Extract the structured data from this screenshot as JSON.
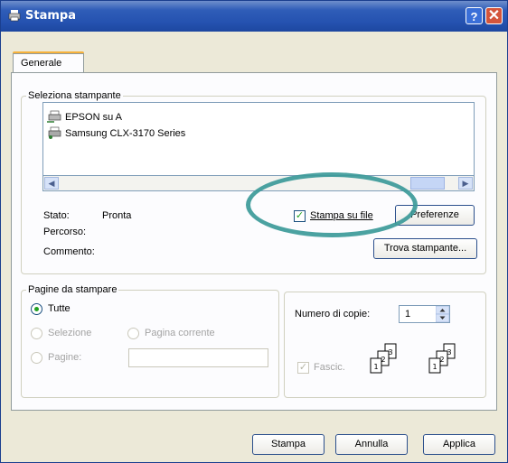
{
  "window": {
    "title": "Stampa",
    "help_glyph": "?",
    "close_glyph": "✕"
  },
  "tabs": [
    "Generale"
  ],
  "printer_group": {
    "legend": "Seleziona stampante",
    "printers": [
      "EPSON su A",
      "Samsung CLX-3170 Series"
    ],
    "status_label": "Stato:",
    "status_value": "Pronta",
    "location_label": "Percorso:",
    "comment_label": "Commento:",
    "print_to_file_label": "Stampa su file",
    "print_to_file_checked": true,
    "preferences_button": "Preferenze",
    "find_printer_button": "Trova stampante..."
  },
  "pages_group": {
    "legend": "Pagine da stampare",
    "all_label": "Tutte",
    "selection_label": "Selezione",
    "current_page_label": "Pagina corrente",
    "pages_label": "Pagine:",
    "selected": "Tutte"
  },
  "copies_group": {
    "copies_label": "Numero di copie:",
    "copies_value": "1",
    "collate_label": "Fascic.",
    "collate_checked": true
  },
  "footer": {
    "print_button": "Stampa",
    "cancel_button": "Annulla",
    "apply_button": "Applica"
  },
  "colors": {
    "title_bar": "#2552b0",
    "annotation_ring": "#3c9a99"
  }
}
